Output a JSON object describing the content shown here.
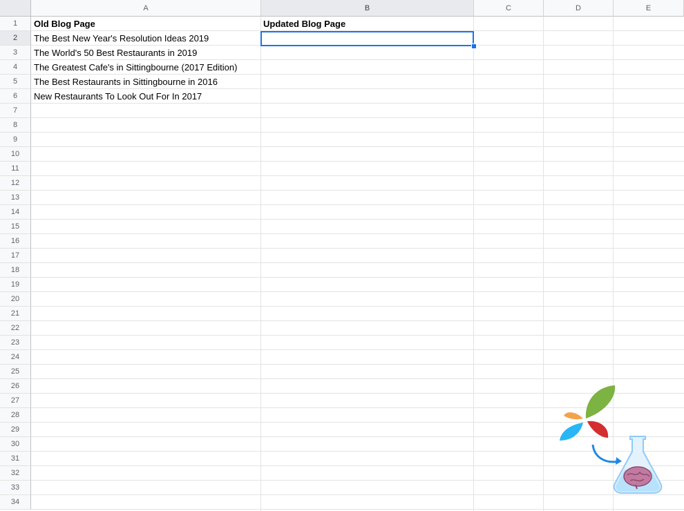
{
  "columns": [
    "A",
    "B",
    "C",
    "D",
    "E"
  ],
  "rows": [
    "1",
    "2",
    "3",
    "4",
    "5",
    "6",
    "7",
    "8",
    "9",
    "10",
    "11",
    "12",
    "13",
    "14",
    "15",
    "16",
    "17",
    "18",
    "19",
    "20",
    "21",
    "22",
    "23",
    "24",
    "25",
    "26",
    "27",
    "28",
    "29",
    "30",
    "31",
    "32",
    "33",
    "34"
  ],
  "cells": {
    "A1": "Old Blog Page",
    "B1": "Updated Blog Page",
    "A2": "The Best New Year's Resolution Ideas 2019",
    "A3": "The World's 50 Best Restaurants in 2019",
    "A4": "The Greatest Cafe's in Sittingbourne (2017 Edition)",
    "A5": "The Best Restaurants in Sittingbourne in 2016",
    "A6": "New Restaurants To Look Out For In 2017"
  },
  "selection": {
    "cell": "B2"
  },
  "colors": {
    "selection": "#1a73e8",
    "logo_green": "#7cb342",
    "logo_red": "#d32f2f",
    "logo_blue": "#29b6f6",
    "logo_orange": "#f4a24b"
  },
  "icons": {
    "logo": "splash-flask-brain-icon"
  }
}
